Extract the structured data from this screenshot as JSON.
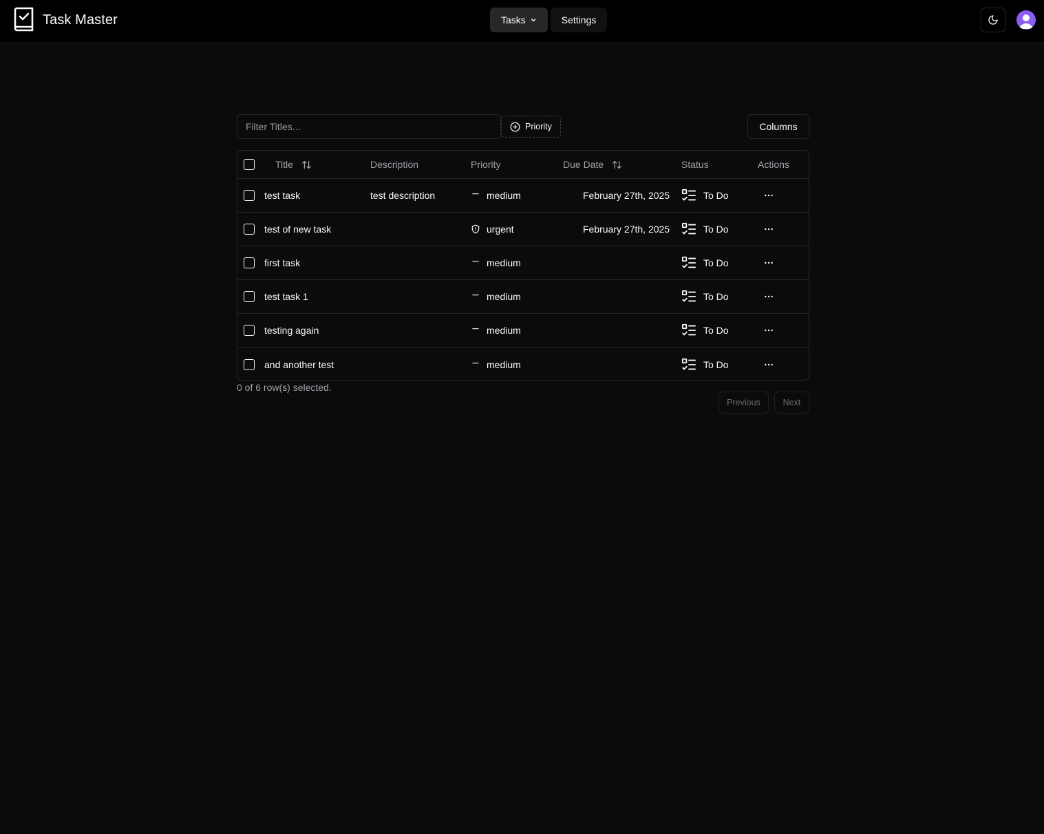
{
  "app": {
    "title": "Task Master"
  },
  "nav": {
    "tasks_label": "Tasks",
    "settings_label": "Settings"
  },
  "toolbar": {
    "filter_placeholder": "Filter Titles...",
    "filter_value": "",
    "priority_filter_label": "Priority",
    "columns_label": "Columns"
  },
  "table": {
    "headers": {
      "title": "Title",
      "description": "Description",
      "priority": "Priority",
      "due_date": "Due Date",
      "status": "Status",
      "actions": "Actions"
    },
    "rows": [
      {
        "title": "test task",
        "description": "test description",
        "priority": "medium",
        "priority_icon": "minus-icon",
        "due_date": "February 27th, 2025",
        "status": "To Do",
        "status_icon": "list-todo-icon"
      },
      {
        "title": "test of new task",
        "description": "",
        "priority": "urgent",
        "priority_icon": "shield-alert-icon",
        "due_date": "February 27th, 2025",
        "status": "To Do",
        "status_icon": "list-todo-icon"
      },
      {
        "title": "first task",
        "description": "",
        "priority": "medium",
        "priority_icon": "minus-icon",
        "due_date": "",
        "status": "To Do",
        "status_icon": "list-todo-icon"
      },
      {
        "title": "test task 1",
        "description": "",
        "priority": "medium",
        "priority_icon": "minus-icon",
        "due_date": "",
        "status": "To Do",
        "status_icon": "list-todo-icon"
      },
      {
        "title": "testing again",
        "description": "",
        "priority": "medium",
        "priority_icon": "minus-icon",
        "due_date": "",
        "status": "To Do",
        "status_icon": "list-todo-icon"
      },
      {
        "title": "and another test",
        "description": "",
        "priority": "medium",
        "priority_icon": "minus-icon",
        "due_date": "",
        "status": "To Do",
        "status_icon": "list-todo-icon"
      }
    ]
  },
  "footer": {
    "selection_text": "0 of 6 row(s) selected.",
    "previous_label": "Previous",
    "next_label": "Next"
  },
  "colors": {
    "background": "#0b0b0b",
    "header_bg": "#000000",
    "border": "#27272a",
    "text": "#fafafa",
    "muted_text": "#a1a1aa",
    "avatar": "#8b5cf6"
  }
}
